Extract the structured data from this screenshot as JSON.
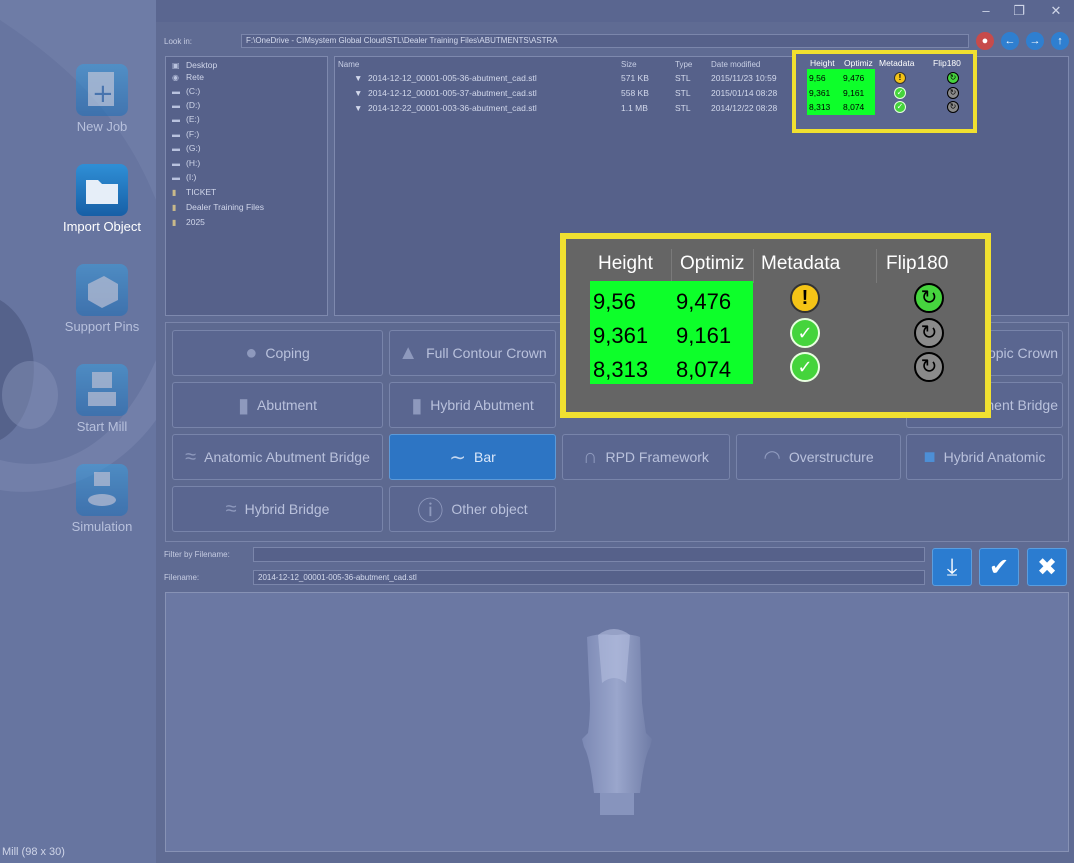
{
  "window": {
    "restore_glyph": "❐",
    "min_glyph": "–",
    "close_glyph": "✕"
  },
  "sidebar": {
    "items": [
      {
        "label": "New Job",
        "icon": "new-job-icon",
        "active": false
      },
      {
        "label": "Import Object",
        "icon": "folder-icon",
        "active": true
      },
      {
        "label": "Support Pins",
        "icon": "support-pins-icon",
        "active": false
      },
      {
        "label": "Start Mill",
        "icon": "mill-icon",
        "active": false
      },
      {
        "label": "Simulation",
        "icon": "simulation-icon",
        "active": false
      }
    ],
    "status": "Mill (98 x 30)"
  },
  "lookin": {
    "label": "Look in:",
    "path": "F:\\OneDrive - CIMsystem Global Cloud\\STL\\Dealer Training Files\\ABUTMENTS\\ASTRA"
  },
  "nav": {
    "back": "←",
    "forward": "→",
    "up": "↑"
  },
  "tree": {
    "items": [
      {
        "label": "Desktop",
        "icon": "desktop-icon"
      },
      {
        "label": "Rete",
        "icon": "network-icon"
      },
      {
        "label": "(C:)",
        "icon": "drive-icon"
      },
      {
        "label": "(D:)",
        "icon": "drive-icon"
      },
      {
        "label": "(E:)",
        "icon": "drive-icon"
      },
      {
        "label": "(F:)",
        "icon": "drive-icon"
      },
      {
        "label": "(G:)",
        "icon": "drive-icon"
      },
      {
        "label": "(H:)",
        "icon": "drive-icon"
      },
      {
        "label": "(I:)",
        "icon": "drive-icon"
      },
      {
        "label": "TICKET",
        "icon": "folder-icon"
      },
      {
        "label": "Dealer Training Files",
        "icon": "folder-icon"
      },
      {
        "label": "2025",
        "icon": "folder-icon"
      }
    ]
  },
  "files": {
    "headers": {
      "name": "Name",
      "size": "Size",
      "type": "Type",
      "date": "Date modified",
      "height": "Height",
      "optimized": "Optimiz",
      "metadata": "Metadata",
      "flip": "Flip180"
    },
    "rows": [
      {
        "name": "2014-12-12_00001-005-36-abutment_cad.stl",
        "size": "571 KB",
        "type": "STL",
        "date": "2015/11/23 10:59",
        "height": "9,56",
        "optimized": "9,476",
        "metadata": "warning",
        "flip": "on"
      },
      {
        "name": "2014-12-12_00001-005-37-abutment_cad.stl",
        "size": "558 KB",
        "type": "STL",
        "date": "2015/01/14 08:28",
        "height": "9,361",
        "optimized": "9,161",
        "metadata": "ok",
        "flip": "off"
      },
      {
        "name": "2014-12-22_00001-003-36-abutment_cad.stl",
        "size": "1.1 MB",
        "type": "STL",
        "date": "2014/12/22 08:28",
        "height": "8,313",
        "optimized": "8,074",
        "metadata": "ok",
        "flip": "off"
      }
    ]
  },
  "zoom": {
    "headers": {
      "height": "Height",
      "optimized": "Optimiz",
      "metadata": "Metadata",
      "flip": "Flip180"
    },
    "rows": [
      {
        "height": "9,56",
        "optimized": "9,476"
      },
      {
        "height": "9,361",
        "optimized": "9,161"
      },
      {
        "height": "8,313",
        "optimized": "8,074"
      }
    ]
  },
  "categories": [
    {
      "label": "Coping",
      "icon": "coping-icon",
      "selected": false
    },
    {
      "label": "Full Contour Crown",
      "icon": "crown-icon",
      "selected": false
    },
    {
      "label": "opic Crown",
      "icon": "crown-icon",
      "selected": false
    },
    {
      "label": "Abutment",
      "icon": "abutment-icon",
      "selected": false
    },
    {
      "label": "Hybrid Abutment",
      "icon": "abutment-icon",
      "selected": false
    },
    {
      "label": "ment Bridge",
      "icon": "bridge-icon",
      "selected": false
    },
    {
      "label": "Anatomic Abutment Bridge",
      "icon": "bridge-icon",
      "selected": false
    },
    {
      "label": "Bar",
      "icon": "bar-icon",
      "selected": true
    },
    {
      "label": "RPD Framework",
      "icon": "rpd-icon",
      "selected": false
    },
    {
      "label": "Overstructure",
      "icon": "overstructure-icon",
      "selected": false
    },
    {
      "label": "Hybrid Anatomic",
      "icon": "anatomic-icon",
      "selected": false
    },
    {
      "label": "Hybrid Bridge",
      "icon": "bridge-icon",
      "selected": false
    },
    {
      "label": "Other object",
      "icon": "question-icon",
      "selected": false
    }
  ],
  "filter": {
    "label": "Filter by Filename:",
    "value": ""
  },
  "filename": {
    "label": "Filename:",
    "value": "2014-12-12_00001-005-36-abutment_cad.stl"
  },
  "colors": {
    "accent": "#2d75c4",
    "highlight": "#f0e030",
    "cell_green": "#0dff2a"
  }
}
